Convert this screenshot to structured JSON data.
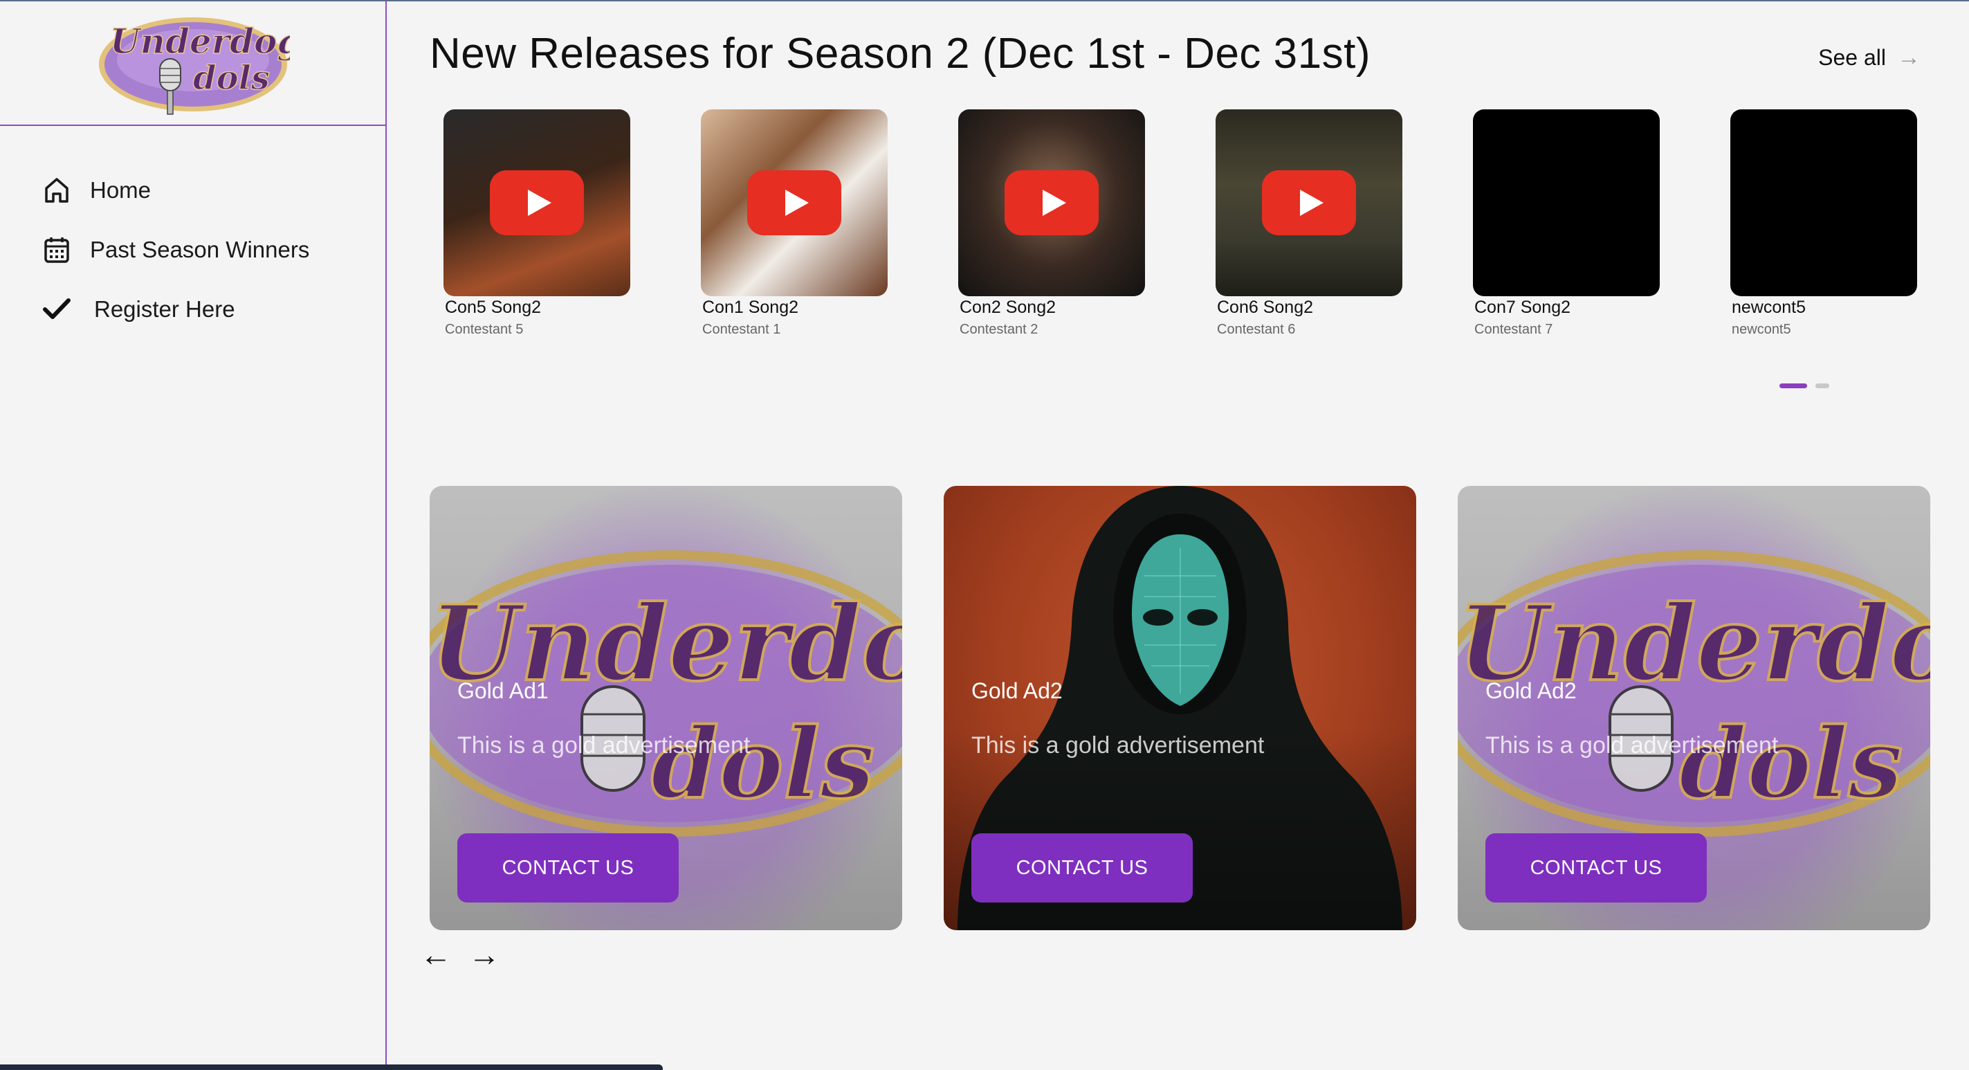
{
  "sidebar": {
    "logo_text_line1": "Underdog",
    "logo_text_line2": "dols",
    "items": [
      {
        "label": "Home",
        "icon": "home-icon"
      },
      {
        "label": "Past Season Winners",
        "icon": "calendar-icon"
      },
      {
        "label": "Register Here",
        "icon": "check-icon"
      }
    ]
  },
  "main": {
    "title": "New Releases for Season 2 (Dec 1st - Dec 31st)",
    "see_all": "See all",
    "see_all_icon": "arrow-right-icon",
    "releases": [
      {
        "title": "Con5 Song2",
        "artist": "Contestant 5",
        "has_video": true
      },
      {
        "title": "Con1 Song2",
        "artist": "Contestant 1",
        "has_video": true
      },
      {
        "title": "Con2 Song2",
        "artist": "Contestant 2",
        "has_video": true
      },
      {
        "title": "Con6 Song2",
        "artist": "Contestant 6",
        "has_video": true
      },
      {
        "title": "Con7 Song2",
        "artist": "Contestant 7",
        "has_video": false
      },
      {
        "title": "newcont5",
        "artist": "newcont5",
        "has_video": false
      }
    ],
    "pager": {
      "pages": 2,
      "active": 1
    },
    "ads": [
      {
        "title": "Gold Ad1",
        "description": "This is a gold advertisement",
        "button": "CONTACT US",
        "image": "underdog-idols-logo"
      },
      {
        "title": "Gold Ad2",
        "description": "This is a gold advertisement",
        "button": "CONTACT US",
        "image": "hooded-figure"
      },
      {
        "title": "Gold Ad2",
        "description": "This is a gold advertisement",
        "button": "CONTACT US",
        "image": "underdog-idols-logo"
      }
    ],
    "carousel_prev": "←",
    "carousel_next": "→"
  },
  "colors": {
    "accent": "#7f2fbf",
    "divider": "#8b4fc2",
    "play_button": "#e62e22",
    "background": "#f4f4f4"
  }
}
